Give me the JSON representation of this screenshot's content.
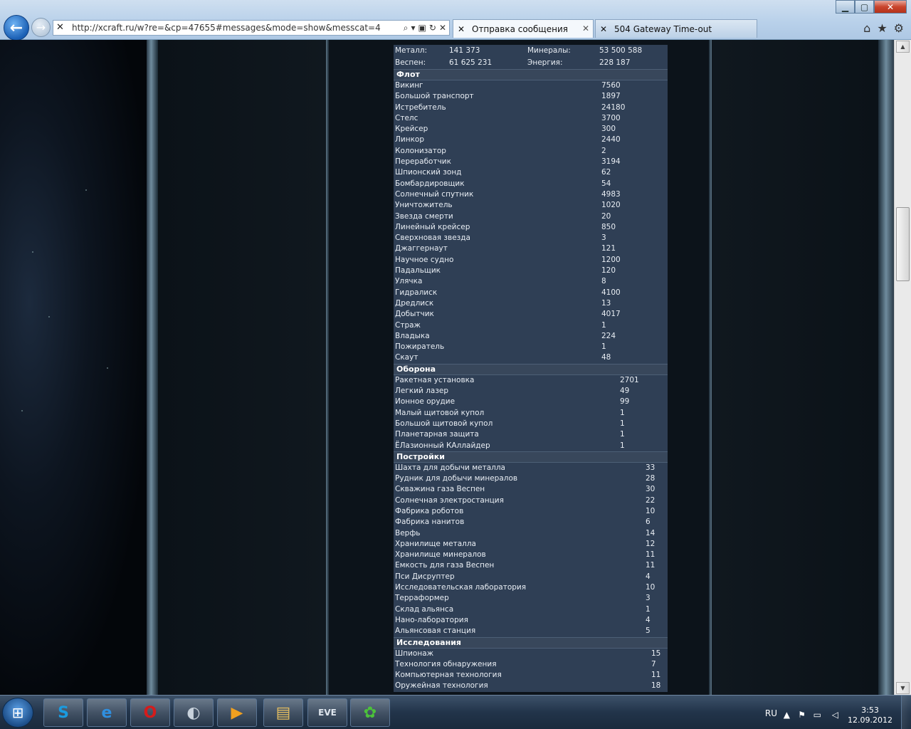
{
  "browser": {
    "url": "http://xcraft.ru/w?re=&cp=47655#messages&mode=show&messcat=4",
    "tabs": [
      {
        "label": "Отправка сообщения"
      },
      {
        "label": "504 Gateway Time-out"
      }
    ]
  },
  "resources": {
    "metal_label": "Металл:",
    "metal_value": "141 373",
    "minerals_label": "Минералы:",
    "minerals_value": "53 500 588",
    "vespen_label": "Веспен:",
    "vespen_value": "61 625 231",
    "energy_label": "Энергия:",
    "energy_value": "228 187"
  },
  "sections": [
    {
      "title": "Флот",
      "rows": [
        [
          "Викинг",
          "7560"
        ],
        [
          "Большой транспорт",
          "1897"
        ],
        [
          "Истребитель",
          "24180"
        ],
        [
          "Стелс",
          "3700"
        ],
        [
          "Крейсер",
          "300"
        ],
        [
          "Линкор",
          "2440"
        ],
        [
          "Колонизатор",
          "2"
        ],
        [
          "Переработчик",
          "3194"
        ],
        [
          "Шпионский зонд",
          "62"
        ],
        [
          "Бомбардировщик",
          "54"
        ],
        [
          "Солнечный спутник",
          "4983"
        ],
        [
          "Уничтожитель",
          "1020"
        ],
        [
          "Звезда смерти",
          "20"
        ],
        [
          "Линейный крейсер",
          "850"
        ],
        [
          "Сверхновая звезда",
          "3"
        ],
        [
          "Джаггернаут",
          "121"
        ],
        [
          "Научное судно",
          "1200"
        ],
        [
          "Падальщик",
          "120"
        ],
        [
          "Улячка",
          "8"
        ],
        [
          "Гидралиск",
          "4100"
        ],
        [
          "Дредлиск",
          "13"
        ],
        [
          "Добытчик",
          "4017"
        ],
        [
          "Страж",
          "1"
        ],
        [
          "Владыка",
          "224"
        ],
        [
          "Пожиратель",
          "1"
        ],
        [
          "Скаут",
          "48"
        ]
      ]
    },
    {
      "title": "Оборона",
      "rows": [
        [
          "Ракетная установка",
          "2701"
        ],
        [
          "Легкий лазер",
          "49"
        ],
        [
          "Ионное орудие",
          "99"
        ],
        [
          "Малый щитовой купол",
          "1"
        ],
        [
          "Большой щитовой купол",
          "1"
        ],
        [
          "Планетарная защита",
          "1"
        ],
        [
          "ЁЛазионный КАллайдер",
          "1"
        ]
      ]
    },
    {
      "title": "Постройки",
      "rows": [
        [
          "Шахта для добычи металла",
          "33"
        ],
        [
          "Рудник для добычи минералов",
          "28"
        ],
        [
          "Скважина газа Веспен",
          "30"
        ],
        [
          "Солнечная электростанция",
          "22"
        ],
        [
          "Фабрика роботов",
          "10"
        ],
        [
          "Фабрика нанитов",
          "6"
        ],
        [
          "Верфь",
          "14"
        ],
        [
          "Хранилище металла",
          "12"
        ],
        [
          "Хранилище минералов",
          "11"
        ],
        [
          "Емкость для газа Веспен",
          "11"
        ],
        [
          "Пси Дисруптер",
          "4"
        ],
        [
          "Исследовательская лаборатория",
          "10"
        ],
        [
          "Терраформер",
          "3"
        ],
        [
          "Склад альянса",
          "1"
        ],
        [
          "Нано-лаборатория",
          "4"
        ],
        [
          "Альянсовая станция",
          "5"
        ]
      ]
    },
    {
      "title": "Исследования",
      "rows": [
        [
          "Шпионаж",
          "15"
        ],
        [
          "Технология обнаружения",
          "7"
        ],
        [
          "Компьютерная технология",
          "11"
        ],
        [
          "Оружейная технология",
          "18"
        ]
      ]
    }
  ],
  "taskbar": {
    "lang": "RU",
    "time": "3:53",
    "date": "12.09.2012",
    "apps": [
      {
        "name": "skype",
        "glyph": "S",
        "color": "#1a9be0"
      },
      {
        "name": "internet-explorer",
        "glyph": "e",
        "color": "#2f8fe0"
      },
      {
        "name": "opera",
        "glyph": "O",
        "color": "#d41c1c"
      },
      {
        "name": "steam",
        "glyph": "◐",
        "color": "#c8d2dc"
      },
      {
        "name": "media-player",
        "glyph": "▶",
        "color": "#f0a020"
      },
      {
        "name": "explorer",
        "glyph": "▤",
        "color": "#e8c060"
      },
      {
        "name": "eve",
        "glyph": "EVE",
        "color": "#dfe6ee"
      },
      {
        "name": "icq",
        "glyph": "✿",
        "color": "#4cc23a"
      }
    ]
  }
}
